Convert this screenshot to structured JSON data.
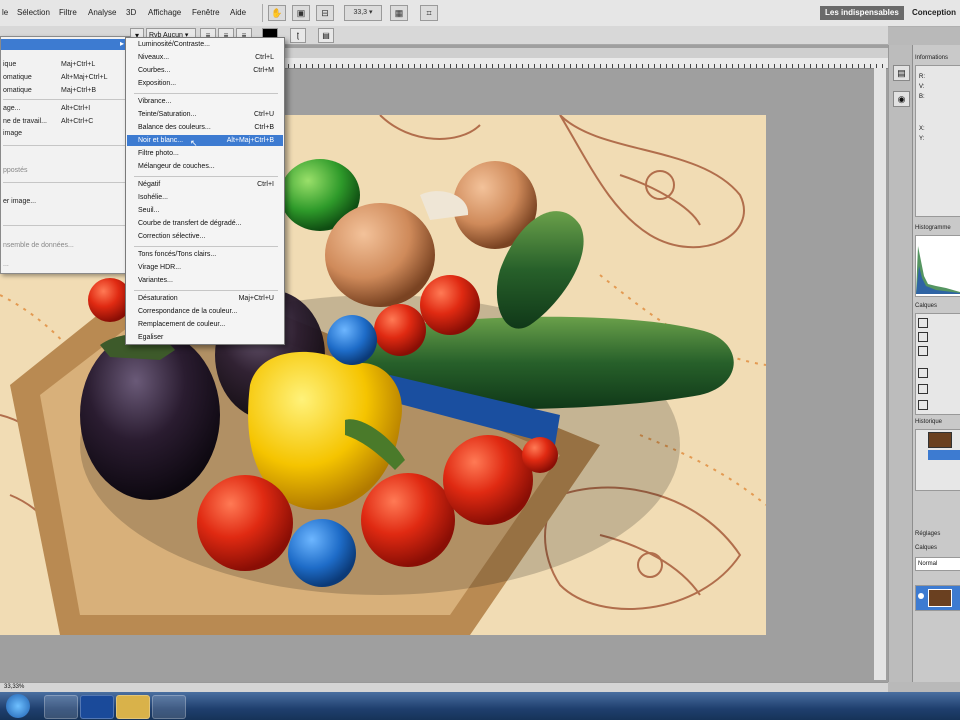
{
  "menubar": {
    "items": [
      "le",
      "Sélection",
      "Filtre",
      "Analyse",
      "3D",
      "Affichage",
      "Fenêtre",
      "Aide"
    ],
    "zoom": "33,3",
    "workspace_primary": "Les indispensables",
    "workspace_secondary": "Conception"
  },
  "optbar": {
    "mode_label": "Rvb",
    "mode_value": "Aucun"
  },
  "left_menu": {
    "items": [
      {
        "label": "",
        "shortcut": ""
      },
      {
        "label": "ique",
        "shortcut": "Maj+Ctrl+L"
      },
      {
        "label": "omatique",
        "shortcut": "Alt+Maj+Ctrl+L"
      },
      {
        "label": "omatique",
        "shortcut": "Maj+Ctrl+B"
      },
      {
        "label": "age...",
        "shortcut": "Alt+Ctrl+I"
      },
      {
        "label": "ne de travail...",
        "shortcut": "Alt+Ctrl+C"
      },
      {
        "label": "image",
        "shortcut": ""
      },
      {
        "label": "ppostés",
        "shortcut": ""
      },
      {
        "label": "er image...",
        "shortcut": ""
      },
      {
        "label": "nsemble de données...",
        "shortcut": ""
      },
      {
        "label": "...",
        "shortcut": ""
      }
    ]
  },
  "submenu": {
    "items": [
      {
        "label": "Luminosité/Contraste...",
        "shortcut": ""
      },
      {
        "label": "Niveaux...",
        "shortcut": "Ctrl+L"
      },
      {
        "label": "Courbes...",
        "shortcut": "Ctrl+M"
      },
      {
        "label": "Exposition...",
        "shortcut": ""
      },
      {
        "label": "Vibrance...",
        "shortcut": ""
      },
      {
        "label": "Teinte/Saturation...",
        "shortcut": "Ctrl+U"
      },
      {
        "label": "Balance des couleurs...",
        "shortcut": "Ctrl+B"
      },
      {
        "label": "Noir et blanc...",
        "shortcut": "Alt+Maj+Ctrl+B"
      },
      {
        "label": "Filtre photo...",
        "shortcut": ""
      },
      {
        "label": "Mélangeur de couches...",
        "shortcut": ""
      },
      {
        "label": "Négatif",
        "shortcut": "Ctrl+I"
      },
      {
        "label": "Isohélie...",
        "shortcut": ""
      },
      {
        "label": "Seuil...",
        "shortcut": ""
      },
      {
        "label": "Courbe de transfert de dégradé...",
        "shortcut": ""
      },
      {
        "label": "Correction sélective...",
        "shortcut": ""
      },
      {
        "label": "Tons foncés/Tons clairs...",
        "shortcut": ""
      },
      {
        "label": "Virage HDR...",
        "shortcut": ""
      },
      {
        "label": "Variantes...",
        "shortcut": ""
      },
      {
        "label": "Désaturation",
        "shortcut": "Maj+Ctrl+U"
      },
      {
        "label": "Correspondance de la couleur...",
        "shortcut": ""
      },
      {
        "label": "Remplacement de couleur...",
        "shortcut": ""
      },
      {
        "label": "Egaliser",
        "shortcut": ""
      }
    ]
  },
  "panels": {
    "info_title": "Informations",
    "histogram_title": "Histogramme",
    "layers_title": "Calques",
    "history_title": "Historique",
    "adjust_title": "Réglages",
    "layers2_title": "Calques",
    "blend_mode": "Normal"
  },
  "status": {
    "zoom": "33,33%"
  },
  "colors": {
    "highlight": "#3d7bd1",
    "accent": "#3d7bd1"
  }
}
